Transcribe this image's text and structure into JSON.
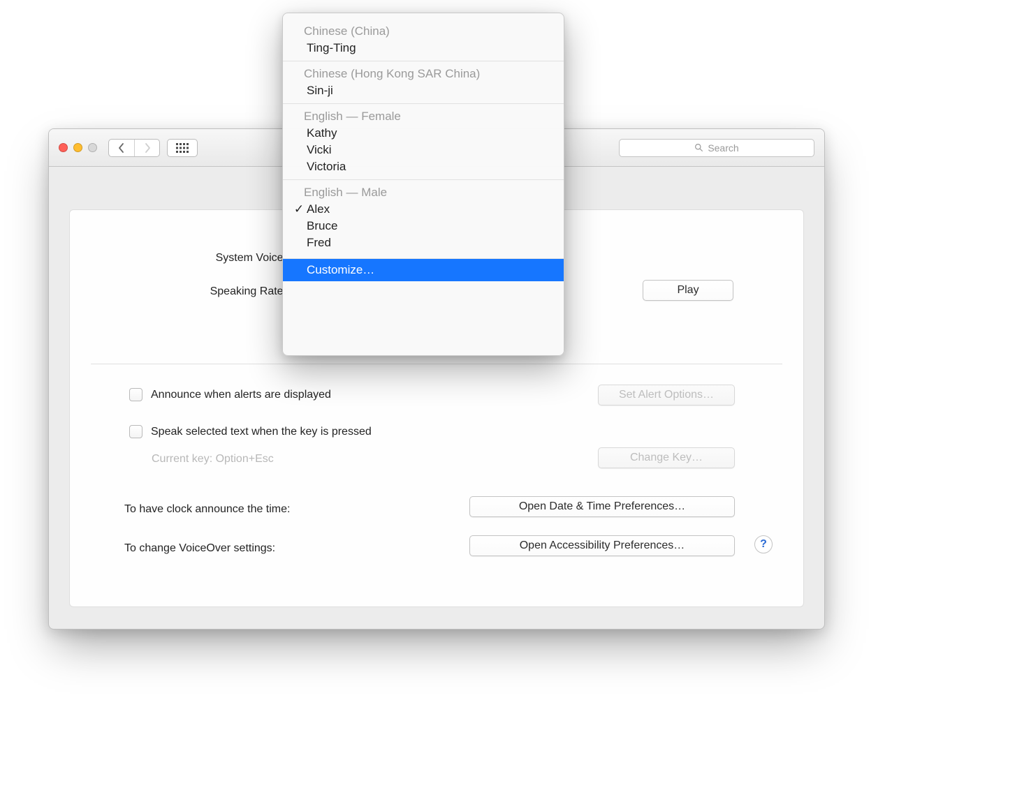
{
  "toolbar": {
    "search_placeholder": "Search"
  },
  "panel": {
    "system_voice_label": "System Voice:",
    "speaking_rate_label": "Speaking Rate:",
    "play_button": "Play",
    "announce_alerts_label": "Announce when alerts are displayed",
    "set_alert_options_button": "Set Alert Options…",
    "speak_selected_label": "Speak selected text when the key is pressed",
    "current_key_label": "Current key: Option+Esc",
    "change_key_button": "Change Key…",
    "clock_announce_label": "To have clock announce the time:",
    "open_datetime_button": "Open Date & Time Preferences…",
    "voiceover_settings_label": "To change VoiceOver settings:",
    "open_accessibility_button": "Open Accessibility Preferences…",
    "help_symbol": "?"
  },
  "popup": {
    "groups": [
      {
        "header": "Chinese (China)",
        "items": [
          "Ting-Ting"
        ]
      },
      {
        "header": "Chinese (Hong Kong SAR China)",
        "items": [
          "Sin-ji"
        ]
      },
      {
        "header": "English — Female",
        "items": [
          "Kathy",
          "Vicki",
          "Victoria"
        ]
      },
      {
        "header": "English — Male",
        "items": [
          "Alex",
          "Bruce",
          "Fred"
        ]
      }
    ],
    "checked_item": "Alex",
    "customize_label": "Customize…"
  }
}
